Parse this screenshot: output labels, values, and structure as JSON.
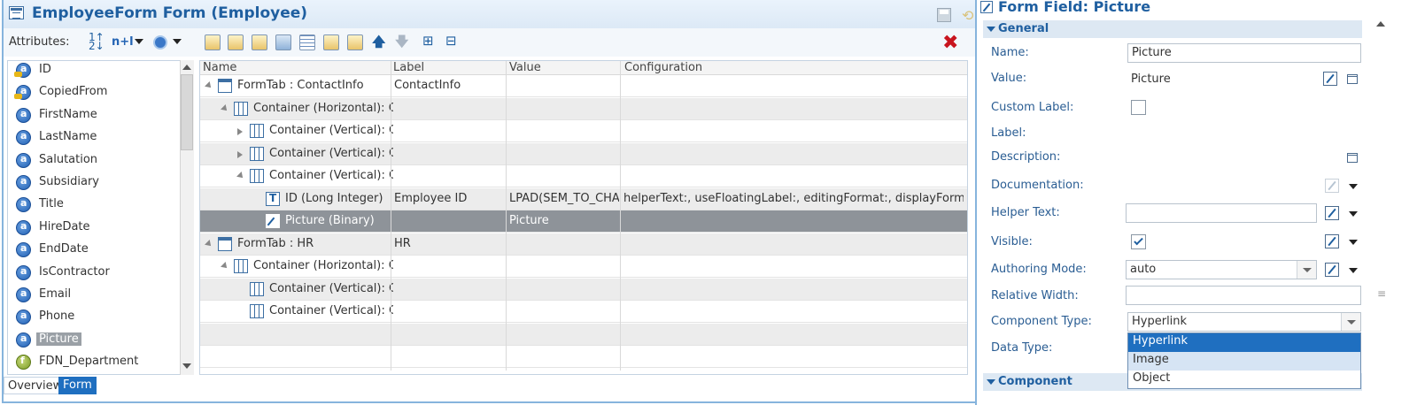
{
  "editor": {
    "title": "EmployeeForm Form (Employee)",
    "attributes_label": "Attributes:",
    "nplus_label": "n+l"
  },
  "attribute_list": [
    {
      "name": "ID",
      "kind": "key"
    },
    {
      "name": "CopiedFrom",
      "kind": "key"
    },
    {
      "name": "FirstName",
      "kind": "attr"
    },
    {
      "name": "LastName",
      "kind": "attr"
    },
    {
      "name": "Salutation",
      "kind": "attr"
    },
    {
      "name": "Subsidiary",
      "kind": "attr"
    },
    {
      "name": "Title",
      "kind": "attr"
    },
    {
      "name": "HireDate",
      "kind": "attr"
    },
    {
      "name": "EndDate",
      "kind": "attr"
    },
    {
      "name": "IsContractor",
      "kind": "attr"
    },
    {
      "name": "Email",
      "kind": "attr"
    },
    {
      "name": "Phone",
      "kind": "attr"
    },
    {
      "name": "Picture",
      "kind": "attr",
      "selected": true
    },
    {
      "name": "FDN_Department",
      "kind": "fn"
    }
  ],
  "tabs": {
    "overview": "Overview",
    "form": "Form"
  },
  "table": {
    "columns": [
      "Name",
      "Label",
      "Value",
      "Configuration"
    ],
    "rows": [
      {
        "name": "FormTab : ContactInfo",
        "label": "ContactInfo",
        "value": "",
        "config": "",
        "indent": 0,
        "twisty": "open",
        "icon": "tab"
      },
      {
        "name": "Container (Horizontal): C...",
        "label": "",
        "value": "",
        "config": "",
        "indent": 1,
        "twisty": "open",
        "icon": "container"
      },
      {
        "name": "Container (Vertical): C...",
        "label": "",
        "value": "",
        "config": "",
        "indent": 2,
        "twisty": "closed",
        "icon": "container"
      },
      {
        "name": "Container (Vertical): C...",
        "label": "",
        "value": "",
        "config": "",
        "indent": 2,
        "twisty": "closed",
        "icon": "container"
      },
      {
        "name": "Container (Vertical): C...",
        "label": "",
        "value": "",
        "config": "",
        "indent": 2,
        "twisty": "open",
        "icon": "container"
      },
      {
        "name": "ID (Long Integer)",
        "label": "Employee ID",
        "value": "LPAD(SEM_TO_CHA...",
        "config": "helperText:, useFloatingLabel:, editingFormat:, displayFormat:, co...",
        "indent": 3,
        "twisty": "",
        "icon": "field"
      },
      {
        "name": "Picture (Binary)",
        "label": "",
        "value": "Picture",
        "config": "",
        "indent": 3,
        "twisty": "",
        "icon": "pic",
        "selected": true
      },
      {
        "name": "FormTab : HR",
        "label": "HR",
        "value": "",
        "config": "",
        "indent": 0,
        "twisty": "open",
        "icon": "tab"
      },
      {
        "name": "Container (Horizontal): C...",
        "label": "",
        "value": "",
        "config": "",
        "indent": 1,
        "twisty": "open",
        "icon": "container"
      },
      {
        "name": "Container (Vertical): C...",
        "label": "",
        "value": "",
        "config": "",
        "indent": 2,
        "twisty": "",
        "icon": "container"
      },
      {
        "name": "Container (Vertical): C...",
        "label": "",
        "value": "",
        "config": "",
        "indent": 2,
        "twisty": "",
        "icon": "container"
      }
    ]
  },
  "properties": {
    "title": "Form Field: Picture",
    "section_general": "General",
    "section_component": "Component",
    "labels": {
      "name": "Name:",
      "value": "Value:",
      "custom_label": "Custom Label:",
      "label": "Label:",
      "description": "Description:",
      "documentation": "Documentation:",
      "helper_text": "Helper Text:",
      "visible": "Visible:",
      "authoring_mode": "Authoring Mode:",
      "relative_width": "Relative Width:",
      "component_type": "Component Type:",
      "data_type": "Data Type:"
    },
    "name_value": "Picture",
    "value_value": "Picture",
    "custom_label_checked": false,
    "visible_checked": true,
    "helper_text_value": "",
    "authoring_mode_value": "auto",
    "relative_width_value": "",
    "component_type_value": "Hyperlink",
    "component_type_options": [
      "Hyperlink",
      "Image",
      "Object"
    ]
  },
  "colors": {
    "accent": "#1f5fa0",
    "selection": "#8e9399",
    "dropdown_active": "#1f6fc0",
    "close_red": "#c8141e"
  }
}
